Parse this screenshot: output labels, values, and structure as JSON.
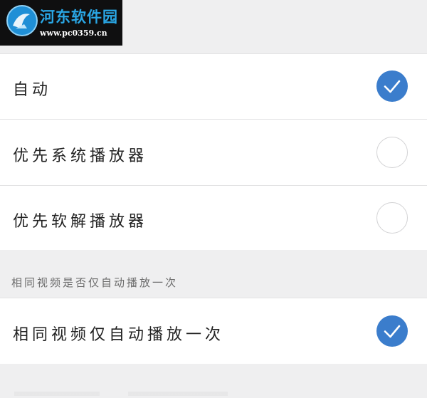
{
  "watermark": {
    "title": "河东软件园",
    "url": "www.pc0359.cn"
  },
  "decoder_options": [
    {
      "label": "自动",
      "checked": true
    },
    {
      "label": "优先系统播放器",
      "checked": false
    },
    {
      "label": "优先软解播放器",
      "checked": false
    }
  ],
  "autoplay_section": {
    "header": "相同视频是否仅自动播放一次",
    "option": {
      "label": "相同视频仅自动播放一次",
      "checked": true
    }
  },
  "colors": {
    "accent": "#3b7dcc",
    "background": "#efeff0",
    "row_background": "#ffffff",
    "divider": "#e2e2e3"
  },
  "icons": {
    "checked": "check-circle-icon",
    "unchecked": "empty-circle-icon",
    "watermark_logo": "hedong-logo-icon"
  }
}
